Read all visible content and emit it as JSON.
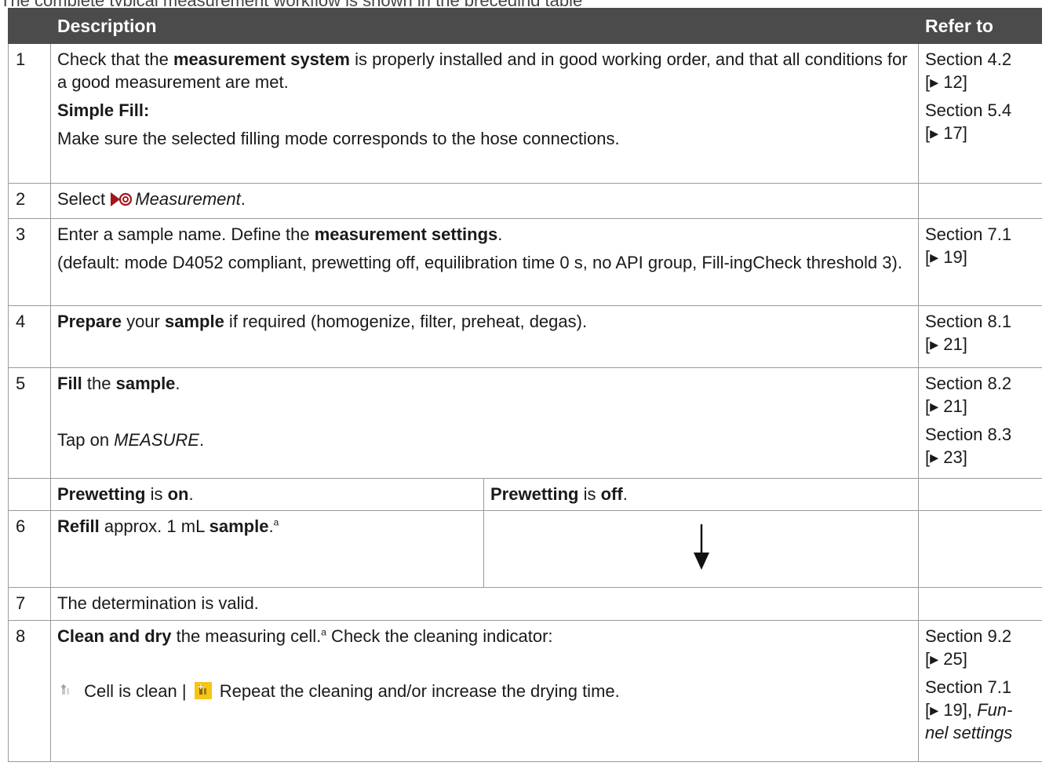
{
  "top_caption": "The complete typical measurement workflow is shown in the preceding table",
  "header": {
    "col_num": "",
    "col_description": "Description",
    "col_refer": "Refer to"
  },
  "rows": {
    "r1": {
      "num": "1",
      "t1": "Check that the ",
      "b1": "measurement system",
      "t2": " is properly installed and in good working order, and that all conditions for a good measurement are met.",
      "simple_fill": "Simple Fill:",
      "simple_fill_text": "Make sure the selected filling mode corresponds to the hose connections.",
      "ref1_a": "Section 4.2",
      "ref1_b": "[▸ 12]",
      "ref2_a": "Section 5.4",
      "ref2_b": "[▸ 17]"
    },
    "r2": {
      "num": "2",
      "t1": "Select ",
      "i1": "Measurement",
      "t2": "."
    },
    "r3": {
      "num": "3",
      "t1": "Enter a sample name. Define the ",
      "b1": "measurement settings",
      "t2": ".",
      "p2": "(default: mode D4052 compliant, prewetting off, equilibration time 0 s, no API group, Fill-ingCheck threshold 3).",
      "ref1_a": "Section 7.1",
      "ref1_b": "[▸ 19]"
    },
    "r4": {
      "num": "4",
      "b1": "Prepare",
      "t1": " your ",
      "b2": "sample",
      "t2": " if required (homogenize, filter, preheat, degas).",
      "ref1_a": "Section 8.1",
      "ref1_b": "[▸ 21]"
    },
    "r5": {
      "num": "5",
      "b1": "Fill",
      "t1": " the ",
      "b2": "sample",
      "t2": ".",
      "t3": "Tap on ",
      "i1": "MEASURE",
      "t4": ".",
      "ref1_a": "Section 8.2",
      "ref1_b": "[▸ 21]",
      "ref2_a": "Section 8.3",
      "ref2_b": "[▸ 23]"
    },
    "branch": {
      "left_b1": "Prewetting",
      "left_t1": " is ",
      "left_b2": "on",
      "left_t2": ".",
      "right_b1": "Prewetting",
      "right_t1": " is ",
      "right_b2": "off",
      "right_t2": "."
    },
    "r6": {
      "num": "6",
      "b1": "Refill",
      "t1": " approx. 1 mL ",
      "b2": "sample",
      "t2": ".",
      "sup": "a"
    },
    "r7": {
      "num": "7",
      "t1": "The determination is valid."
    },
    "r8": {
      "num": "8",
      "b1": "Clean and dry",
      "t1": " the measuring cell.",
      "sup": "a",
      "t2": " Check the cleaning indicator:",
      "t3": " Cell is clean | ",
      "t4": " Repeat the cleaning and/or increase the drying time.",
      "ref1_a": "Section 9.2",
      "ref1_b": "[▸ 25]",
      "ref2_a": "Section 7.1",
      "ref2_b": "[▸ 19], ",
      "ref2_i1": "Fun-",
      "ref2_i2": "nel settings"
    }
  },
  "colors": {
    "header_bg": "#4b4b4b",
    "border": "#9a9a9a",
    "measurement_icon": "#a3161b",
    "warning_icon_bg": "#f5c518"
  },
  "icons": {
    "measurement": "measurement-icon",
    "clean": "cell-clean-icon",
    "dirty": "cell-dirty-icon",
    "arrow": "arrow-down-icon"
  }
}
